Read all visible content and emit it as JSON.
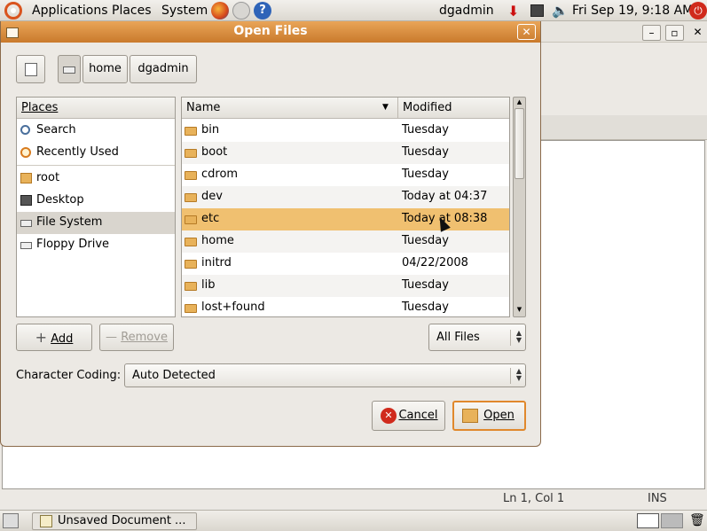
{
  "top_panel": {
    "menus": [
      "Applications",
      "Places",
      "System"
    ],
    "user": "dgadmin",
    "clock": "Fri Sep 19,  9:18 AM"
  },
  "dialog": {
    "title": "Open Files",
    "path_buttons": [
      "home",
      "dgadmin"
    ],
    "places_header": "Places",
    "places": [
      {
        "label": "Search",
        "icon": "search-icon"
      },
      {
        "label": "Recently Used",
        "icon": "recent-icon"
      },
      {
        "label": "root",
        "icon": "home-folder-icon"
      },
      {
        "label": "Desktop",
        "icon": "desktop-icon"
      },
      {
        "label": "File System",
        "icon": "drive-icon",
        "selected": true
      },
      {
        "label": "Floppy Drive",
        "icon": "floppy-icon"
      }
    ],
    "columns": {
      "name": "Name",
      "modified": "Modified"
    },
    "files": [
      {
        "name": "bin",
        "modified": "Tuesday"
      },
      {
        "name": "boot",
        "modified": "Tuesday"
      },
      {
        "name": "cdrom",
        "modified": "Tuesday"
      },
      {
        "name": "dev",
        "modified": "Today at 04:37"
      },
      {
        "name": "etc",
        "modified": "Today at 08:38",
        "selected": true
      },
      {
        "name": "home",
        "modified": "Tuesday"
      },
      {
        "name": "initrd",
        "modified": "04/22/2008"
      },
      {
        "name": "lib",
        "modified": "Tuesday"
      },
      {
        "name": "lost+found",
        "modified": "Tuesday"
      }
    ],
    "add_label": "Add",
    "remove_label": "Remove",
    "filter_value": "All Files",
    "encoding_label": "Character Coding:",
    "encoding_value": "Auto Detected",
    "cancel_label": "Cancel",
    "open_label": "Open",
    "selection_color": "#f0c070",
    "titlebar_color": "#d98b3a"
  },
  "editor": {
    "status_position": "Ln 1, Col 1",
    "status_mode": "INS"
  },
  "taskbar": {
    "task_label": "Unsaved Document ..."
  }
}
